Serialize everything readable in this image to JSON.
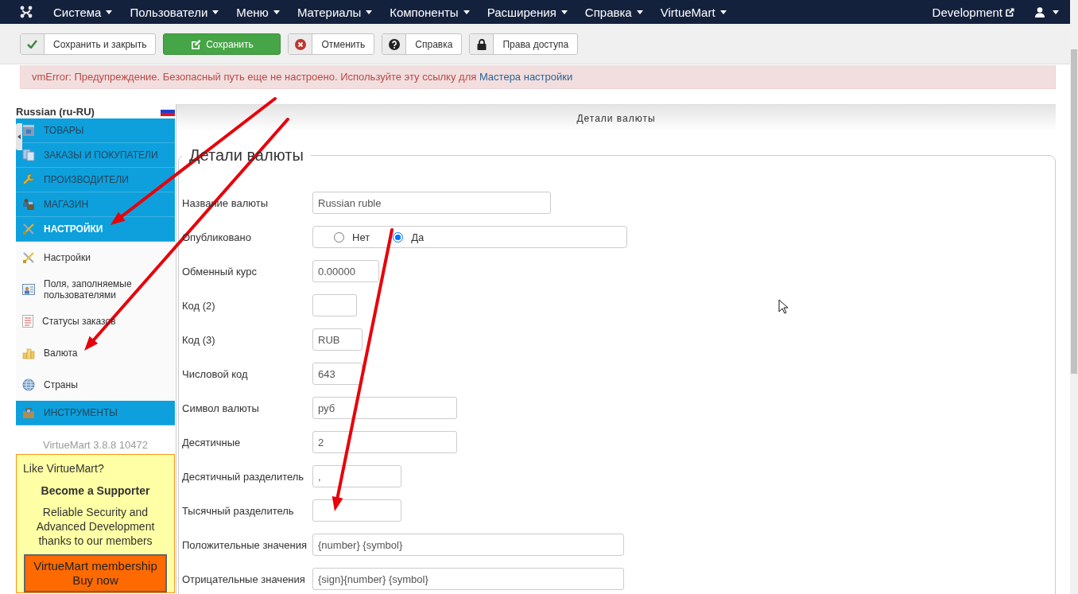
{
  "top_menu": {
    "items": [
      {
        "label": "Система"
      },
      {
        "label": "Пользователи"
      },
      {
        "label": "Меню"
      },
      {
        "label": "Материалы"
      },
      {
        "label": "Компоненты"
      },
      {
        "label": "Расширения"
      },
      {
        "label": "Справка"
      },
      {
        "label": "VirtueMart"
      }
    ],
    "site_link": "Development"
  },
  "toolbar": {
    "buttons": [
      {
        "label": "Сохранить и закрыть",
        "kind": "default"
      },
      {
        "label": "Сохранить",
        "kind": "primary"
      },
      {
        "label": "Отменить",
        "kind": "default"
      },
      {
        "label": "Справка",
        "kind": "default"
      },
      {
        "label": "Права доступа",
        "kind": "default"
      }
    ]
  },
  "alert": {
    "message": "vmError: Предупреждение. Безопасный путь еще не настроено. Используйте эту ссылку для",
    "link": "Мастера настройки"
  },
  "sidebar": {
    "language": "Russian (ru-RU)",
    "menu": [
      {
        "label": "ТОВАРЫ",
        "selected": false
      },
      {
        "label": "ЗАКАЗЫ И ПОКУПАТЕЛИ",
        "selected": false
      },
      {
        "label": "ПРОИЗВОДИТЕЛИ",
        "selected": false
      },
      {
        "label": "МАГАЗИН",
        "selected": false
      },
      {
        "label": "НАСТРОЙКИ",
        "selected": true,
        "children": [
          {
            "label": "Настройки"
          },
          {
            "label": "Поля, заполняемые пользователями"
          },
          {
            "label": "Статусы заказов"
          },
          {
            "label": "Валюта"
          },
          {
            "label": "Страны"
          }
        ]
      },
      {
        "label": "ИНСТРУМЕНТЫ",
        "selected": false
      }
    ],
    "version": "VirtueMart 3.8.8 10472",
    "promo": {
      "question": "Like VirtueMart?",
      "title": "Become a Supporter",
      "text": "Reliable Security and Advanced Development thanks to our members",
      "button": "VirtueMart membership Buy now"
    }
  },
  "panel": {
    "header": "Детали валюты",
    "legend": "Детали валюты",
    "fields": [
      {
        "label": "Название валюты",
        "kind": "text",
        "value": "Russian ruble"
      },
      {
        "label": "Опубликовано",
        "kind": "radio",
        "options": [
          {
            "label": "Нет",
            "selected": false
          },
          {
            "label": "Да",
            "selected": true
          }
        ]
      },
      {
        "label": "Обменный курс",
        "kind": "text",
        "value": "0.00000"
      },
      {
        "label": "Код (2)",
        "kind": "text"
      },
      {
        "label": "Код (3)",
        "kind": "text",
        "value": "RUB"
      },
      {
        "label": "Числовой код",
        "kind": "text",
        "value": "643"
      },
      {
        "label": "Символ валюты",
        "kind": "text",
        "value": "руб"
      },
      {
        "label": "Десятичные",
        "kind": "text",
        "value": "2"
      },
      {
        "label": "Десятичный разделитель",
        "kind": "text",
        "value": ","
      },
      {
        "label": "Тысячный разделитель",
        "kind": "text"
      },
      {
        "label": "Положительные значения",
        "kind": "text",
        "value": "{number} {symbol}"
      },
      {
        "label": "Отрицательные значения",
        "kind": "text",
        "value": "{sign}{number} {symbol}"
      }
    ]
  }
}
